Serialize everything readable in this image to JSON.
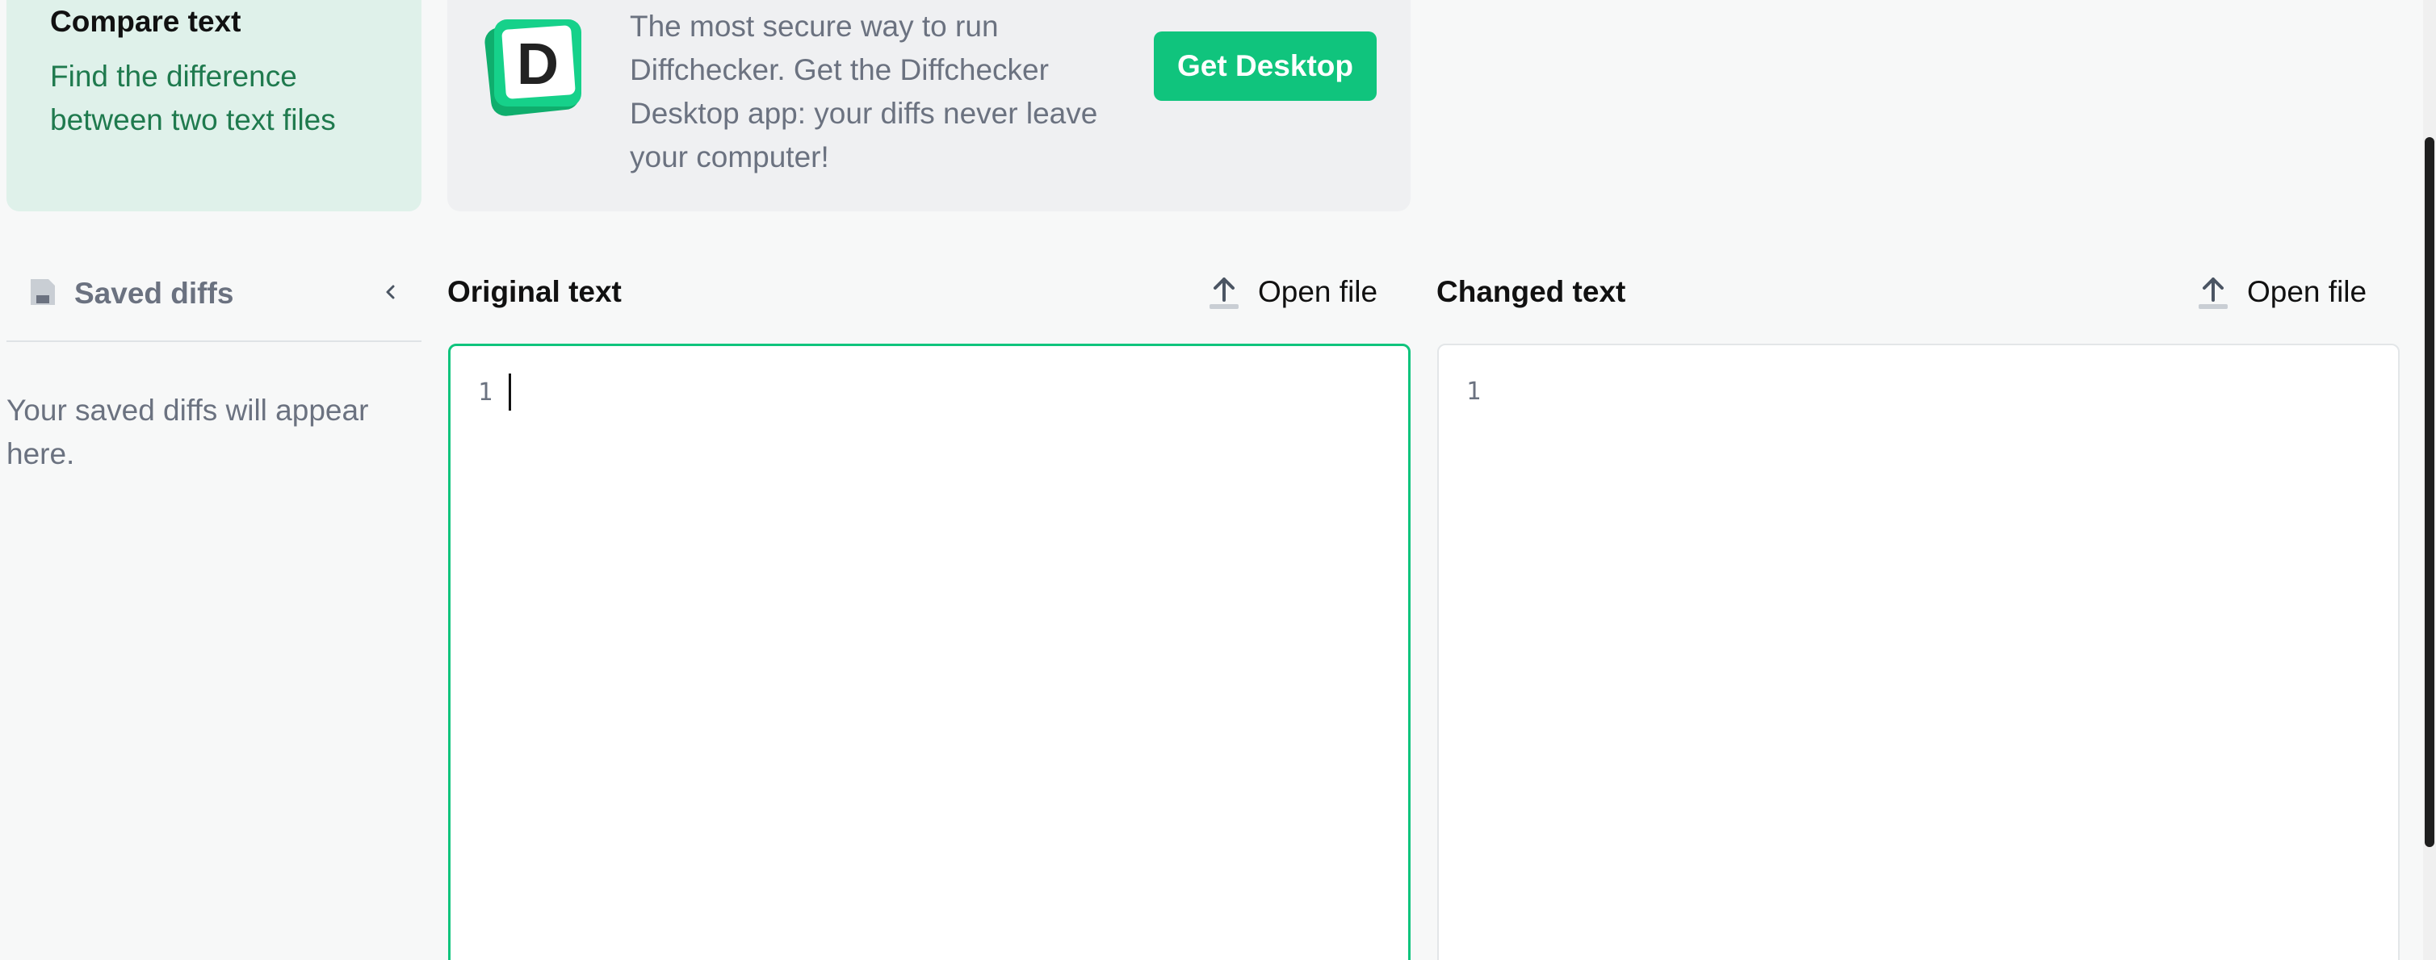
{
  "compare_card": {
    "title": "Compare text",
    "description": "Find the difference between two text files"
  },
  "desktop_promo": {
    "logo_letter": "D",
    "text": "The most secure way to run Diffchecker. Get the Diffchecker Desktop app: your diffs never leave your computer!",
    "button_label": "Get Desktop"
  },
  "sidebar": {
    "title": "Saved diffs",
    "empty_message": "Your saved diffs will appear here."
  },
  "panes": {
    "original": {
      "title": "Original text",
      "open_file_label": "Open file",
      "line_number": "1",
      "content": ""
    },
    "changed": {
      "title": "Changed text",
      "open_file_label": "Open file",
      "line_number": "1",
      "content": ""
    }
  },
  "colors": {
    "accent": "#10c47d",
    "compare_card_bg": "#dff1ea",
    "promo_bg": "#eff0f2"
  }
}
